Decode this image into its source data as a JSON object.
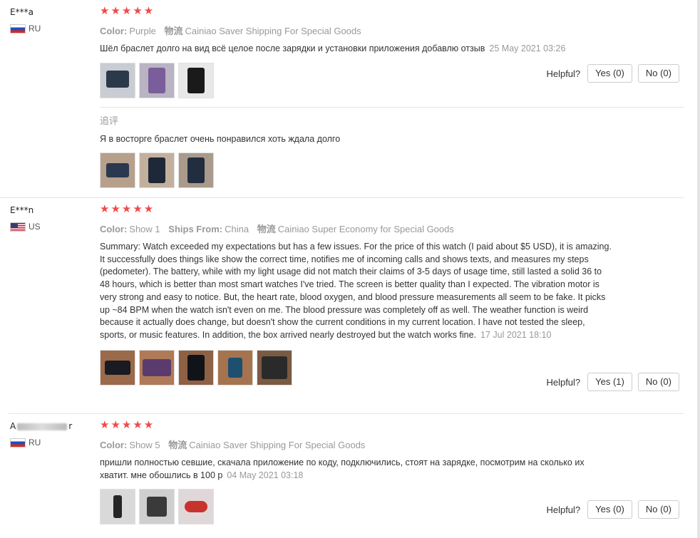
{
  "helpful_label": "Helpful?",
  "reviews": [
    {
      "user": "E***a",
      "country": "RU",
      "stars": "★★★★★",
      "color_label": "Color:",
      "color_value": "Purple",
      "ship_label": "物流",
      "ship_value": "Cainiao Saver Shipping For Special Goods",
      "text": "Шёл браслет долго на вид всё целое после зарядки и установки приложения добавлю отзыв",
      "date": "25 May 2021 03:26",
      "yes": "Yes (0)",
      "no": "No (0)",
      "followup_title": "追评",
      "followup_text": "Я в восторге браслет очень понравился хоть ждала долго"
    },
    {
      "user": "E***n",
      "country": "US",
      "stars": "★★★★★",
      "color_label": "Color:",
      "color_value": "Show 1",
      "ships_from_label": "Ships From:",
      "ships_from_value": "China",
      "ship_label": "物流",
      "ship_value": "Cainiao Super Economy for Special Goods",
      "text": "Summary: Watch exceeded my expectations but has a few issues. For the price of this watch (I paid about $5 USD), it is amazing. It successfully does things like show the correct time, notifies me of incoming calls and shows texts, and measures my steps (pedometer). The battery, while with my light usage did not match their claims of 3-5 days of usage time, still lasted a solid 36 to 48 hours, which is better than most smart watches I've tried. The screen is better quality than I expected. The vibration motor is very strong and easy to notice. But, the heart rate, blood oxygen, and blood pressure measurements all seem to be fake. It picks up ~84 BPM when the watch isn't even on me. The blood pressure was completely off as well. The weather function is weird because it actually does change, but doesn't show the current conditions in my current location. I have not tested the sleep, sports, or music features. In addition, the box arrived nearly destroyed but the watch works fine.",
      "date": "17 Jul 2021 18:10",
      "yes": "Yes (1)",
      "no": "No (0)"
    },
    {
      "user_prefix": "A",
      "user_suffix": "r",
      "country": "RU",
      "stars": "★★★★★",
      "color_label": "Color:",
      "color_value": "Show 5",
      "ship_label": "物流",
      "ship_value": "Cainiao Saver Shipping For Special Goods",
      "text": "пришли полностью севшие, скачала приложение по коду, подключились, стоят на зарядке, посмотрим на сколько их хватит. мне обошлись в 100 р",
      "date": "04 May 2021 03:18",
      "yes": "Yes (0)",
      "no": "No (0)"
    }
  ]
}
